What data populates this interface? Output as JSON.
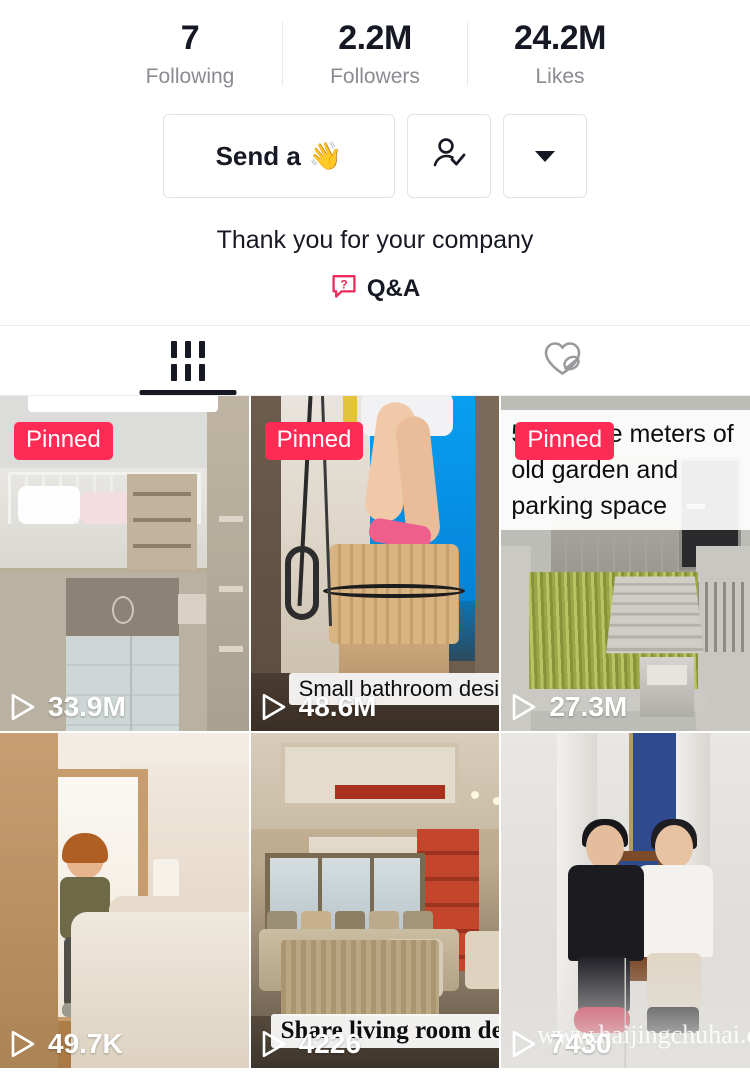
{
  "profile": {
    "stats": [
      {
        "value": "7",
        "label": "Following",
        "name": "following"
      },
      {
        "value": "2.2M",
        "label": "Followers",
        "name": "followers"
      },
      {
        "value": "24.2M",
        "label": "Likes",
        "name": "likes"
      }
    ],
    "actions": {
      "primary_label": "Send a",
      "primary_emoji": "👋",
      "follow_icon": "person-check-icon",
      "more_icon": "chevron-down-icon"
    },
    "bio": "Thank you for your company",
    "qa": {
      "label": "Q&A",
      "icon": "question-bubble-icon",
      "color": "#eb2b5b"
    }
  },
  "tabs": [
    {
      "name": "videos",
      "icon": "grid-icon",
      "active": true
    },
    {
      "name": "liked",
      "icon": "heart-slash-icon",
      "active": false
    }
  ],
  "theme": {
    "accent": "#fe2c55",
    "text": "#161823",
    "muted": "#8a8b91",
    "border": "#e3e3e4"
  },
  "videos": [
    {
      "name": "video-1",
      "views": "33.9M",
      "pinned_label": "Pinned",
      "pinned": true,
      "caption": "",
      "caption_position": "none"
    },
    {
      "name": "video-2",
      "views": "48.6M",
      "pinned_label": "Pinned",
      "pinned": true,
      "caption": "Small bathroom design",
      "caption_position": "bottom"
    },
    {
      "name": "video-3",
      "views": "27.3M",
      "pinned_label": "Pinned",
      "pinned": true,
      "caption": "50 square meters of old garden and parking space",
      "caption_position": "top"
    },
    {
      "name": "video-4",
      "views": "49.7K",
      "pinned_label": "",
      "pinned": false,
      "caption": "",
      "caption_position": "none"
    },
    {
      "name": "video-5",
      "views": "4226",
      "pinned_label": "",
      "pinned": false,
      "caption": "Share living room design",
      "caption_position": "bottom-serif"
    },
    {
      "name": "video-6",
      "views": "7430",
      "pinned_label": "",
      "pinned": false,
      "caption": "",
      "caption_position": "none",
      "watermark": "www.haijingchuhai.com"
    }
  ]
}
